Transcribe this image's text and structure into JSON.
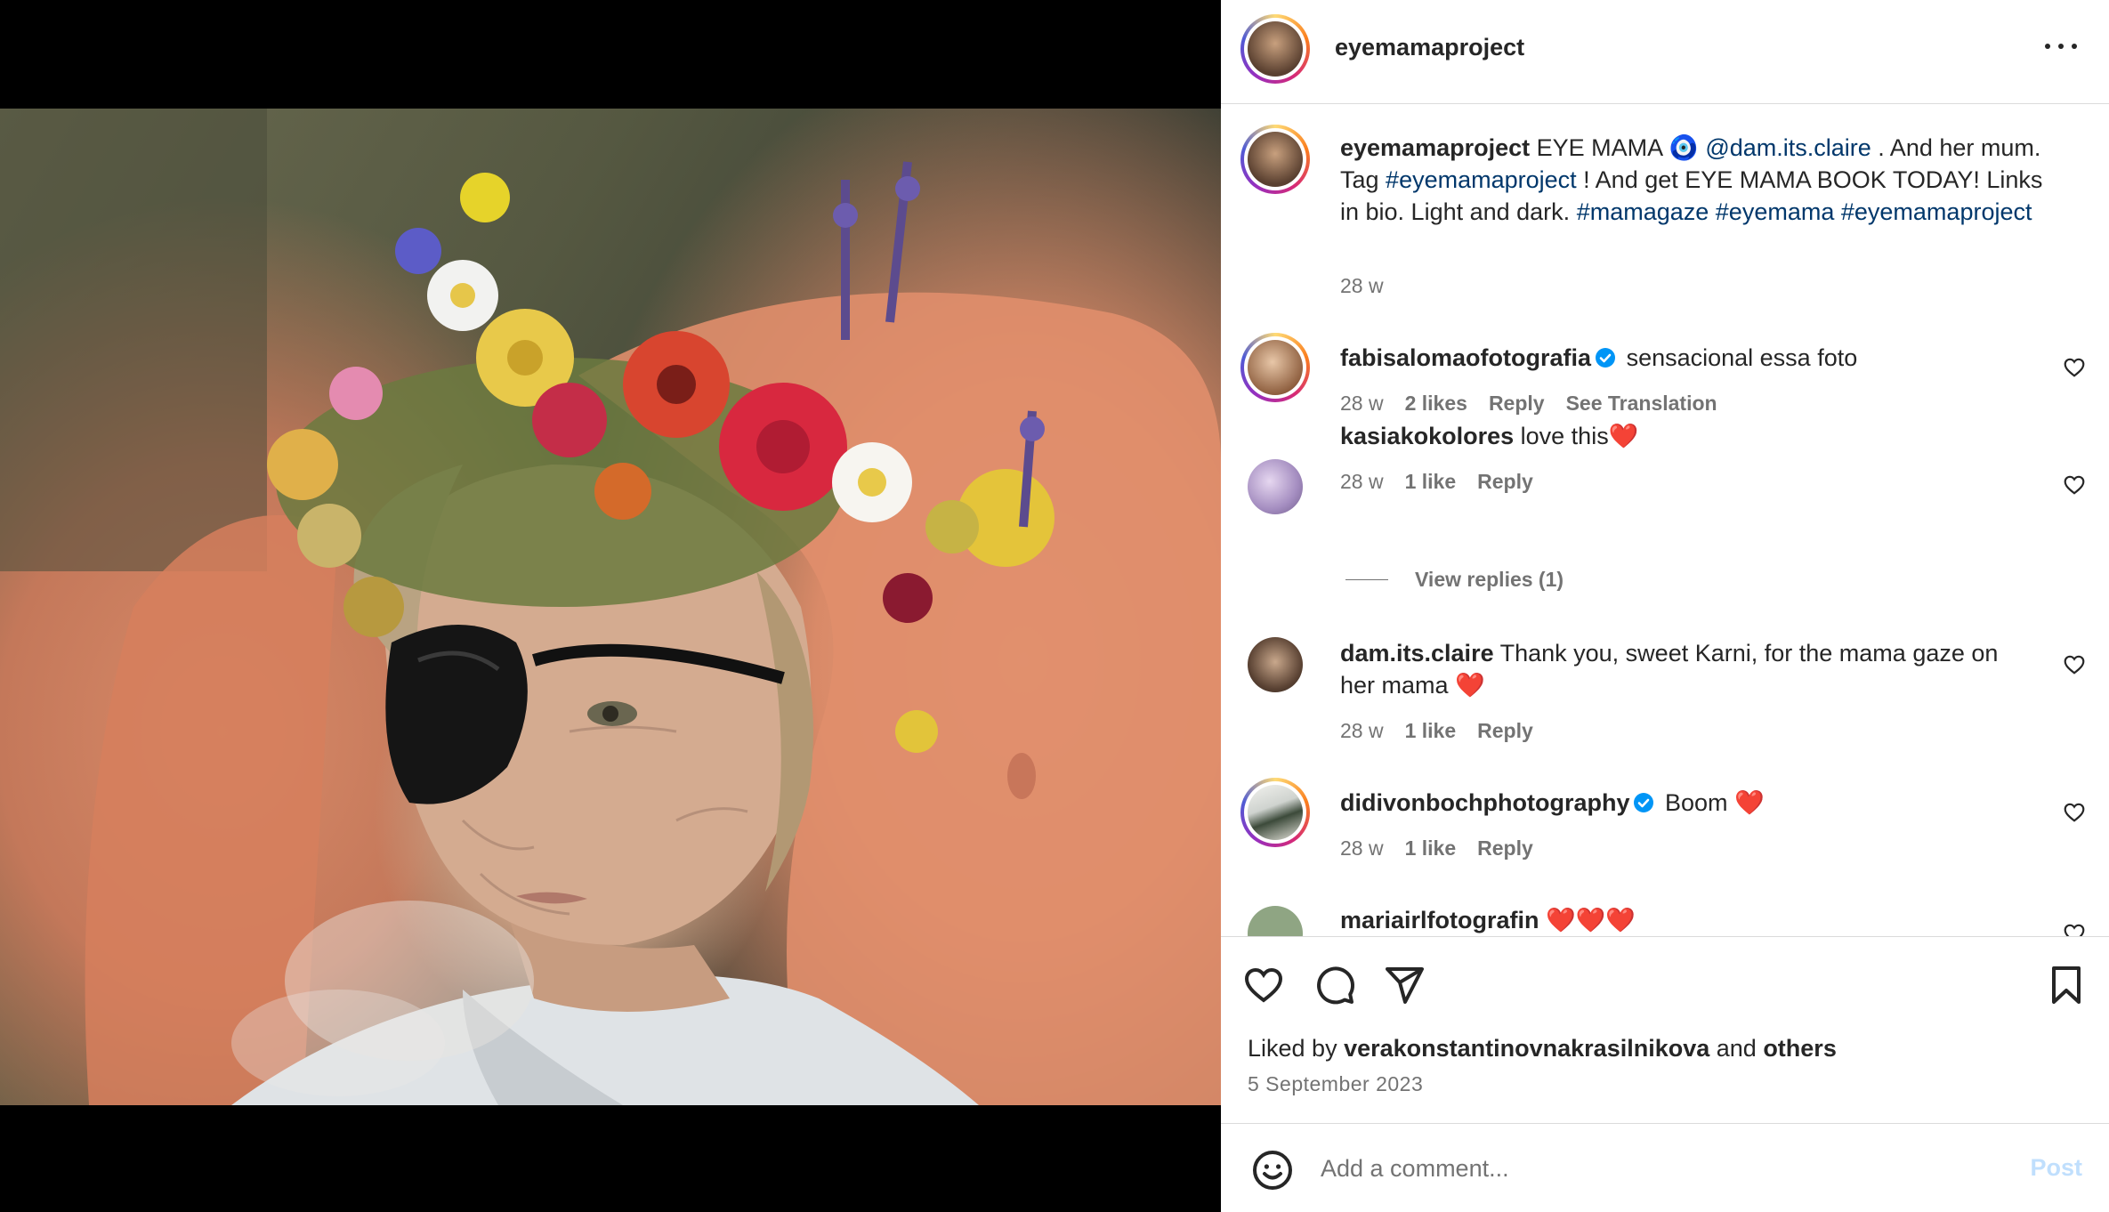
{
  "post": {
    "author": "eyemamaproject",
    "caption_prefix": "EYE MAMA ",
    "caption_emoji": "🧿",
    "caption_mention": "@dam.its.claire",
    "caption_mid": " . And her mum. Tag ",
    "caption_tag1": "#eyemamaproject",
    "caption_mid2": " ! And get EYE MAMA BOOK TODAY! Links in bio. Light and dark. ",
    "caption_tag2": "#mamagaze",
    "caption_tag3": " #eyemama",
    "caption_tag4": "#eyemamaproject",
    "caption_time": "28 w"
  },
  "comments": [
    {
      "user": "fabisalomaofotografia",
      "verified": true,
      "text": "sensacional essa foto",
      "time": "28 w",
      "likes": "2 likes",
      "reply": "Reply",
      "translate": "See Translation"
    },
    {
      "user": "kasiakokolores",
      "verified": false,
      "text": "love this❤️",
      "time": "28 w",
      "likes": "1 like",
      "reply": "Reply",
      "replies_label": "View replies (1)"
    },
    {
      "user": "dam.its.claire",
      "verified": false,
      "text": "Thank you, sweet Karni, for the mama gaze on her mama ❤️",
      "time": "28 w",
      "likes": "1 like",
      "reply": "Reply"
    },
    {
      "user": "didivonbochphotography",
      "verified": true,
      "text": "Boom ❤️",
      "time": "28 w",
      "likes": "1 like",
      "reply": "Reply"
    },
    {
      "user": "mariairlfotografin",
      "verified": false,
      "text": "❤️❤️❤️"
    }
  ],
  "likes_summary": {
    "prefix": "Liked by ",
    "user": "verakonstantinovnakrasilnikova",
    "and": " and ",
    "others": "others"
  },
  "date": "5 September 2023",
  "add_comment": {
    "placeholder": "Add a comment...",
    "post_label": "Post"
  },
  "icons": [
    "more-icon",
    "verified-badge-icon",
    "heart-icon",
    "comment-icon",
    "share-icon",
    "bookmark-icon",
    "emoji-icon"
  ],
  "colors": {
    "link": "#00376b",
    "muted": "#737373",
    "verified": "#0095f6",
    "post_disabled": "#c0dffd",
    "heart_red": "#e0393e"
  }
}
